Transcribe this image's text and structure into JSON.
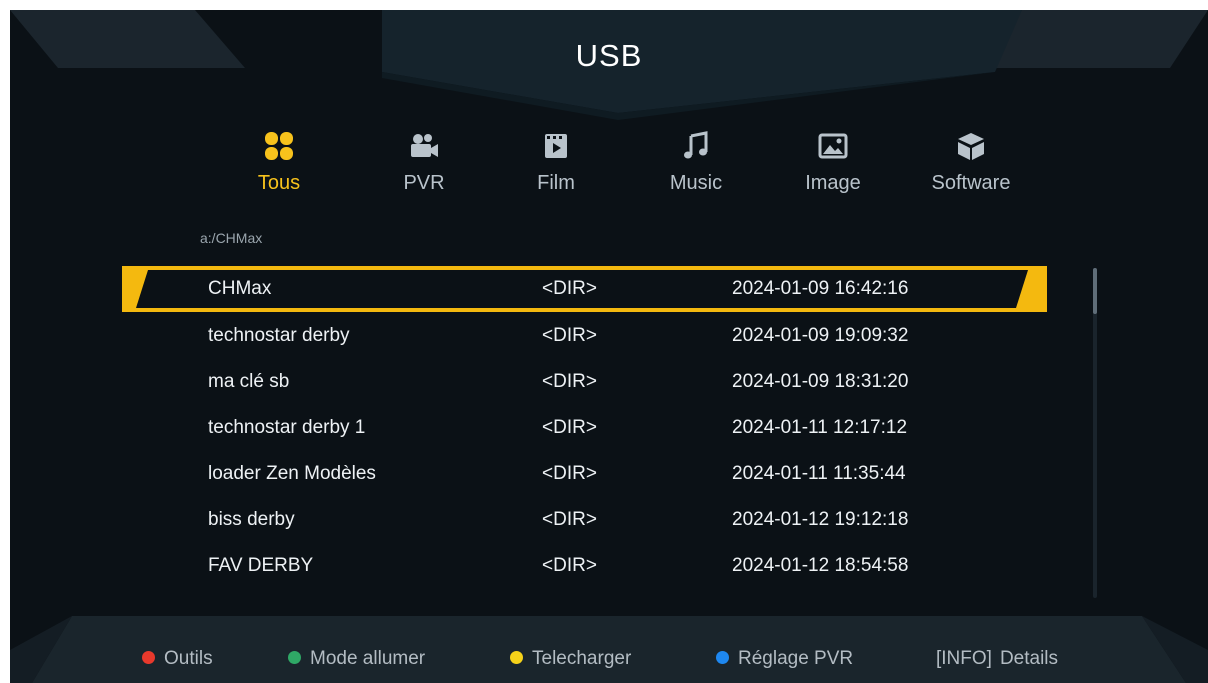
{
  "title": "USB",
  "categories": [
    {
      "label": "Tous",
      "icon": "grid-icon",
      "active": true
    },
    {
      "label": "PVR",
      "icon": "camera-icon",
      "active": false
    },
    {
      "label": "Film",
      "icon": "film-icon",
      "active": false
    },
    {
      "label": "Music",
      "icon": "music-icon",
      "active": false
    },
    {
      "label": "Image",
      "icon": "image-icon",
      "active": false
    },
    {
      "label": "Software",
      "icon": "package-icon",
      "active": false
    }
  ],
  "path": "a:/CHMax",
  "files": [
    {
      "name": "CHMax",
      "type": "<DIR>",
      "date": "2024-01-09 16:42:16"
    },
    {
      "name": "technostar derby",
      "type": "<DIR>",
      "date": "2024-01-09 19:09:32"
    },
    {
      "name": "ma clé sb",
      "type": "<DIR>",
      "date": "2024-01-09 18:31:20"
    },
    {
      "name": "technostar derby 1",
      "type": "<DIR>",
      "date": "2024-01-11 12:17:12"
    },
    {
      "name": "loader Zen Modèles",
      "type": "<DIR>",
      "date": "2024-01-11 11:35:44"
    },
    {
      "name": "biss derby",
      "type": "<DIR>",
      "date": "2024-01-12 19:12:18"
    },
    {
      "name": "FAV DERBY",
      "type": "<DIR>",
      "date": "2024-01-12 18:54:58"
    }
  ],
  "selected_index": 0,
  "footer": {
    "red": "Outils",
    "green": "Mode allumer",
    "yellow": "Telecharger",
    "blue": "Réglage PVR",
    "info_key": "[INFO]",
    "info_label": "Details"
  },
  "colors": {
    "accent": "#f7c21c",
    "red": "#e8392c",
    "green": "#2fa866",
    "yellow": "#f5d21a",
    "blue": "#1e88f0"
  }
}
